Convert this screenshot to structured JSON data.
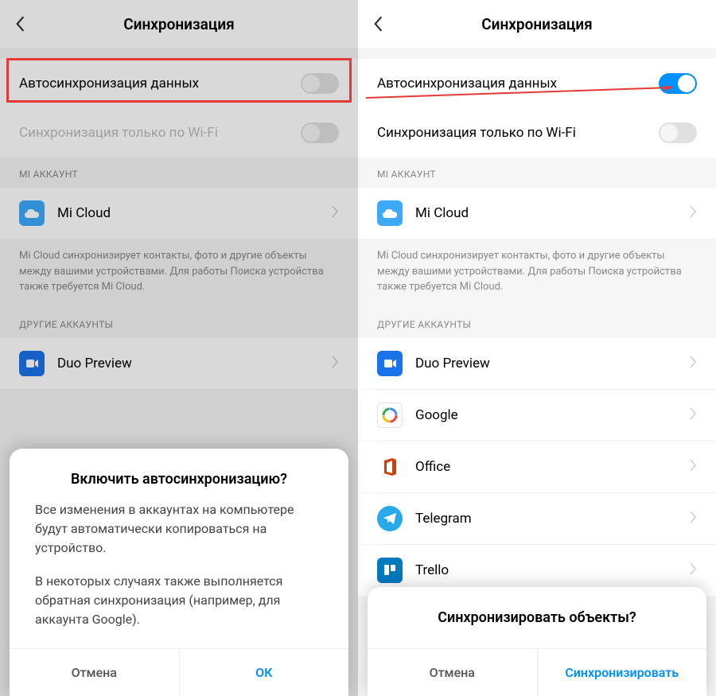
{
  "left": {
    "header": {
      "title": "Синхронизация"
    },
    "autosync": {
      "label": "Автосинхронизация данных",
      "on": false
    },
    "wifi": {
      "label": "Синхронизация только по Wi-Fi",
      "on": false
    },
    "sections": {
      "mi_account": "MI АККАУНТ",
      "other_accounts": "ДРУГИЕ АККАУНТЫ"
    },
    "mi_cloud": {
      "label": "Mi Cloud"
    },
    "mi_desc": "Mi Cloud синхронизирует контакты, фото и другие объекты между вашими устройствами. Для работы Поиска устройства также требуется Mi Cloud.",
    "accounts": [
      {
        "label": "Duo Preview"
      }
    ],
    "dialog": {
      "title": "Включить автосинхронизацию?",
      "p1": "Все изменения в аккаунтах на компьютере будут автоматически копироваться на устройство.",
      "p2": "В некоторых случаях также выполняется обратная синхронизация (например, для аккаунта Google).",
      "cancel": "Отмена",
      "ok": "ОК"
    }
  },
  "right": {
    "header": {
      "title": "Синхронизация"
    },
    "autosync": {
      "label": "Автосинхронизация данных",
      "on": true
    },
    "wifi": {
      "label": "Синхронизация только по Wi-Fi",
      "on": false
    },
    "sections": {
      "mi_account": "MI АККАУНТ",
      "other_accounts": "ДРУГИЕ АККАУНТЫ"
    },
    "mi_cloud": {
      "label": "Mi Cloud"
    },
    "mi_desc": "Mi Cloud синхронизирует контакты, фото и другие объекты между вашими устройствами. Для работы Поиска устройства также требуется Mi Cloud.",
    "accounts": [
      {
        "label": "Duo Preview"
      },
      {
        "label": "Google"
      },
      {
        "label": "Office"
      },
      {
        "label": "Telegram"
      },
      {
        "label": "Trello"
      }
    ],
    "dialog": {
      "title": "Синхронизировать объекты?",
      "cancel": "Отмена",
      "ok": "Синхронизировать"
    }
  }
}
